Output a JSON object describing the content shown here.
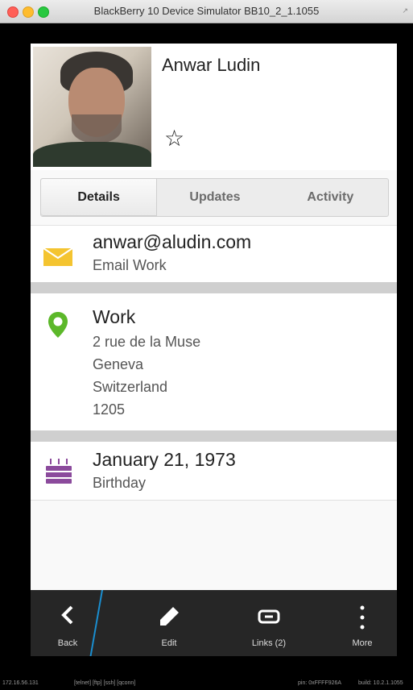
{
  "window": {
    "title": "BlackBerry 10 Device Simulator BB10_2_1.1055"
  },
  "contact": {
    "name": "Anwar Ludin"
  },
  "tabs": [
    {
      "label": "Details",
      "active": true
    },
    {
      "label": "Updates",
      "active": false
    },
    {
      "label": "Activity",
      "active": false
    }
  ],
  "email": {
    "value": "anwar@aludin.com",
    "type": "Email Work",
    "icon": "envelope-icon",
    "color": "#f4c430"
  },
  "address": {
    "type": "Work",
    "street": "2 rue de la Muse",
    "city": "Geneva",
    "country": "Switzerland",
    "postal": "1205",
    "icon": "location-pin-icon",
    "color": "#5cb82a"
  },
  "birthday": {
    "date": "January 21, 1973",
    "label": "Birthday",
    "icon": "birthday-cake-icon",
    "color": "#8b4a9c"
  },
  "actions": {
    "back": "Back",
    "edit": "Edit",
    "links": "Links (2)",
    "more": "More"
  },
  "status": {
    "ip": "172.16.56.131",
    "services": "[telnet]  [ftp]  [ssh]  [qconn]",
    "pin": "pin: 0xFFFF926A",
    "build": "build: 10.2.1.1055"
  },
  "accent": "#1a8fd1"
}
